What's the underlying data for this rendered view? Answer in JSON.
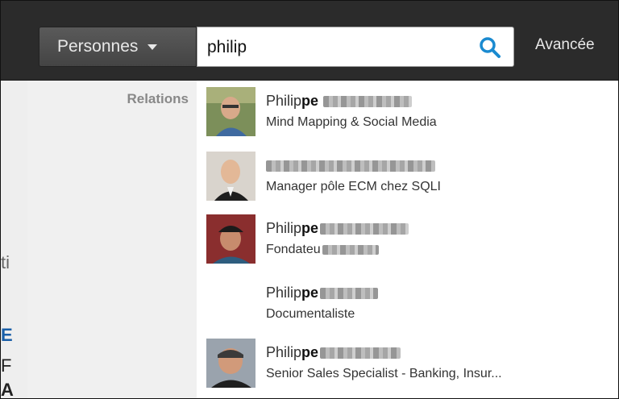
{
  "search": {
    "filter_label": "Personnes",
    "query": "philip",
    "advanced_label": "Avancée"
  },
  "left_fragments": {
    "ti": "ti",
    "e": "E",
    "f": "F",
    "a": "A"
  },
  "dropdown": {
    "category": "Relations",
    "results": [
      {
        "name_prefix": "Philip",
        "name_bold": "pe",
        "headline": "Mind Mapping & Social Media"
      },
      {
        "name_prefix": "",
        "name_bold": "",
        "headline": "Manager pôle ECM chez SQLI"
      },
      {
        "name_prefix": "Philip",
        "name_bold": "pe",
        "headline": "Fondateu"
      },
      {
        "name_prefix": "Philip",
        "name_bold": "pe",
        "headline": "Documentaliste"
      },
      {
        "name_prefix": "Philip",
        "name_bold": "pe",
        "headline": "Senior Sales Specialist - Banking, Insur..."
      }
    ]
  },
  "colors": {
    "topbar": "#2b2b2b",
    "search_icon": "#1a8ad0"
  }
}
